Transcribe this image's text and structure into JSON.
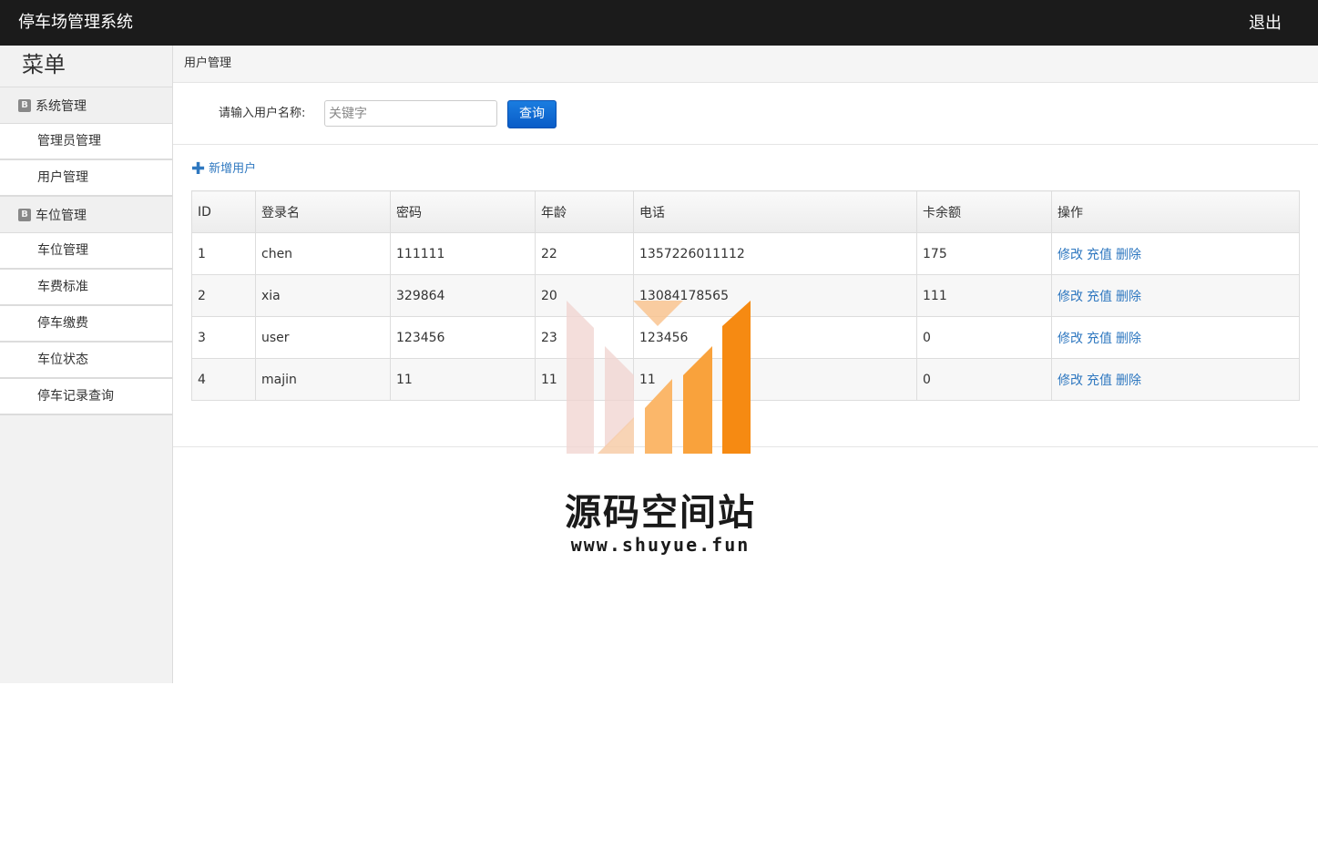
{
  "header": {
    "app_title": "停车场管理系统",
    "logout_label": "退出"
  },
  "sidebar": {
    "title": "菜单",
    "groups": [
      {
        "label": "系统管理",
        "items": [
          "管理员管理",
          "用户管理"
        ]
      },
      {
        "label": "车位管理",
        "items": [
          "车位管理",
          "车费标准",
          "停车缴费",
          "车位状态",
          "停车记录查询"
        ]
      }
    ]
  },
  "breadcrumb": "用户管理",
  "search": {
    "label": "请输入用户名称:",
    "placeholder": "关键字",
    "value": "",
    "button_label": "查询"
  },
  "add_user_label": "新增用户",
  "table": {
    "headers": [
      "ID",
      "登录名",
      "密码",
      "年龄",
      "电话",
      "卡余额",
      "操作"
    ],
    "rows": [
      [
        "1",
        "chen",
        "111111",
        "22",
        "1357226011112",
        "175"
      ],
      [
        "2",
        "xia",
        "329864",
        "20",
        "13084178565",
        "111"
      ],
      [
        "3",
        "user",
        "123456",
        "23",
        "123456",
        "0"
      ],
      [
        "4",
        "majin",
        "11",
        "11",
        "11",
        "0"
      ]
    ],
    "actions": [
      "修改",
      "充值",
      "删除"
    ]
  },
  "watermark": {
    "text": "源码空间站",
    "url": "www.shuyue.fun"
  }
}
